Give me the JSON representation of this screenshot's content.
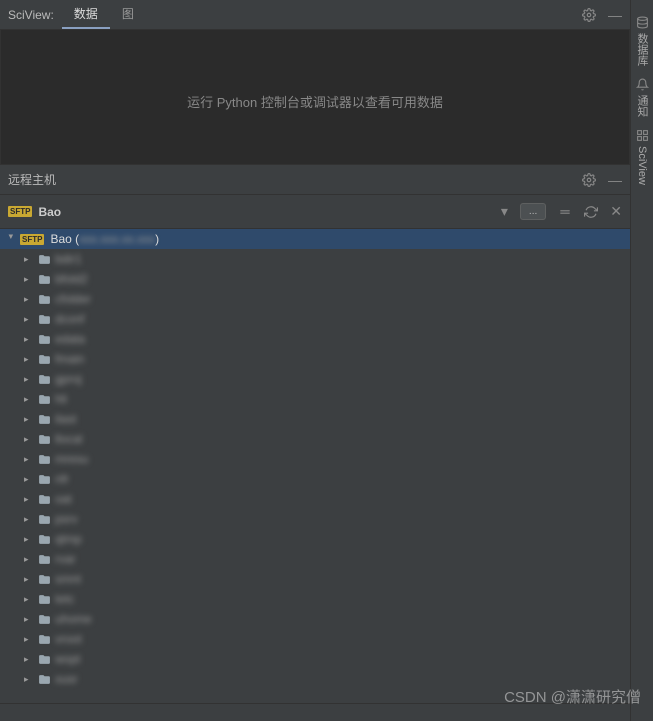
{
  "sciview": {
    "title": "SciView:",
    "tabs": [
      {
        "label": "数据",
        "active": true
      },
      {
        "label": "图",
        "active": false
      }
    ],
    "empty_text": "运行 Python 控制台或调试器以查看可用数据"
  },
  "remote": {
    "title": "远程主机",
    "connection_name": "Bao",
    "root_label": "Bao (",
    "root_addr": "xxx.xxx.xx.xxx",
    "root_close": ")",
    "items": [
      "bdir1",
      "bfold2",
      "cfolder",
      "dconf",
      "edata",
      "fmain",
      "gproj",
      "hli",
      "ilast",
      "llocal",
      "mresu",
      "nfr",
      "oat",
      "psrv",
      "qtmp",
      "rvar",
      "smnt",
      "tetc",
      "uhome",
      "vroot",
      "wopt",
      "xusr"
    ]
  },
  "rail": {
    "items": [
      {
        "label": "数据库",
        "icon": "db"
      },
      {
        "label": "通知",
        "icon": "bell"
      },
      {
        "label": "SciView",
        "icon": "grid"
      }
    ]
  },
  "watermark": "CSDN @潇潇研究僧"
}
